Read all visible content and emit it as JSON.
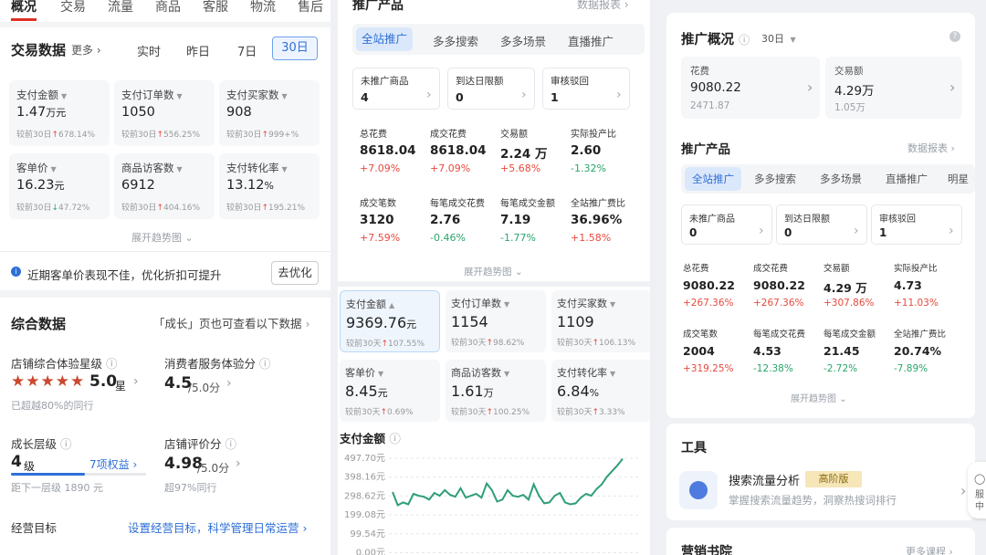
{
  "left": {
    "tabs": [
      "概况",
      "交易",
      "流量",
      "商品",
      "客服",
      "物流",
      "售后"
    ],
    "trade": {
      "title": "交易数据",
      "more": "更多",
      "ranges": [
        "实时",
        "昨日",
        "7日",
        "30日"
      ],
      "metrics": [
        {
          "label": "支付金额",
          "value": "1.47",
          "unit": "万元",
          "cmp": "较前30日",
          "delta": "678.14%",
          "dir": "up"
        },
        {
          "label": "支付订单数",
          "value": "1050",
          "unit": "",
          "cmp": "较前30日",
          "delta": "556.25%",
          "dir": "up"
        },
        {
          "label": "支付买家数",
          "value": "908",
          "unit": "",
          "cmp": "较前30日",
          "delta": "999+%",
          "dir": "up"
        },
        {
          "label": "客单价",
          "value": "16.23",
          "unit": "元",
          "cmp": "较前30日",
          "delta": "47.72%",
          "dir": "down"
        },
        {
          "label": "商品访客数",
          "value": "6912",
          "unit": "",
          "cmp": "较前30日",
          "delta": "404.16%",
          "dir": "up"
        },
        {
          "label": "支付转化率",
          "value": "13.12",
          "unit": "%",
          "cmp": "较前30日",
          "delta": "195.21%",
          "dir": "up"
        }
      ],
      "expand": "展开趋势图"
    },
    "tip": {
      "text": "近期客单价表现不佳，优化折扣可提升",
      "button": "去优化"
    },
    "summary": {
      "title": "综合数据",
      "link": "「成长」页也可查看以下数据",
      "star_label": "店铺综合体验星级",
      "star_value": "5.0",
      "star_unit": "星",
      "star_sub": "已超越80%的同行",
      "svc_label": "消费者服务体验分",
      "svc_value": "4.5",
      "svc_unit": "/5.0分",
      "growth_label": "成长层级",
      "growth_value": "4",
      "growth_unit": "级",
      "growth_benefit": "7项权益",
      "growth_sub": "距下一层级 1890 元",
      "growth_progress": 0.55,
      "eval_label": "店铺评价分",
      "eval_value": "4.98",
      "eval_unit": "/5.0分",
      "eval_sub": "超97%同行",
      "goal_label": "经营目标",
      "goal_link": "设置经营目标，科学管理日常运营"
    }
  },
  "middle": {
    "title": "推广产品",
    "report": "数据报表",
    "tabs": [
      "全站推广",
      "多多搜索",
      "多多场景",
      "直播推广"
    ],
    "status": [
      {
        "label": "未推广商品",
        "value": "4"
      },
      {
        "label": "到达日限额",
        "value": "0"
      },
      {
        "label": "审核驳回",
        "value": "1"
      }
    ],
    "stats": [
      {
        "label": "总花费",
        "value": "8618.04",
        "delta": "+7.09%",
        "dir": "up"
      },
      {
        "label": "成交花费",
        "value": "8618.04",
        "delta": "+7.09%",
        "dir": "up"
      },
      {
        "label": "交易额",
        "value": "2.24 万",
        "delta": "+5.68%",
        "dir": "up"
      },
      {
        "label": "实际投产比",
        "value": "2.60",
        "delta": "-1.32%",
        "dir": "down"
      },
      {
        "label": "成交笔数",
        "value": "3120",
        "delta": "+7.59%",
        "dir": "up"
      },
      {
        "label": "每笔成交花费",
        "value": "2.76",
        "delta": "-0.46%",
        "dir": "down"
      },
      {
        "label": "每笔成交金额",
        "value": "7.19",
        "delta": "-1.77%",
        "dir": "down"
      },
      {
        "label": "全站推广费比",
        "value": "36.96%",
        "delta": "+1.58%",
        "dir": "up"
      }
    ],
    "expand": "展开趋势图",
    "metrics": [
      {
        "label": "支付金额",
        "value": "9369.76",
        "unit": "元",
        "cmp": "较前30天",
        "delta": "107.55%",
        "dir": "up"
      },
      {
        "label": "支付订单数",
        "value": "1154",
        "unit": "",
        "cmp": "较前30天",
        "delta": "98.62%",
        "dir": "up"
      },
      {
        "label": "支付买家数",
        "value": "1109",
        "unit": "",
        "cmp": "较前30天",
        "delta": "106.13%",
        "dir": "up"
      },
      {
        "label": "客单价",
        "value": "8.45",
        "unit": "元",
        "cmp": "较前30天",
        "delta": "0.69%",
        "dir": "up"
      },
      {
        "label": "商品访客数",
        "value": "1.61",
        "unit": "万",
        "cmp": "较前30天",
        "delta": "100.25%",
        "dir": "up"
      },
      {
        "label": "支付转化率",
        "value": "6.84",
        "unit": "%",
        "cmp": "较前30天",
        "delta": "3.33%",
        "dir": "up"
      }
    ],
    "chart_title": "支付金额"
  },
  "chart_data": {
    "type": "line",
    "title": "支付金额",
    "ytick_labels": [
      "497.70元",
      "398.16元",
      "298.62元",
      "199.08元",
      "99.54元",
      "0.00元"
    ],
    "yticks": [
      497.7,
      398.16,
      298.62,
      199.08,
      99.54,
      0
    ],
    "ylim": [
      0,
      497.7
    ],
    "grid": true,
    "series": [
      {
        "values": [
          320,
          250,
          265,
          255,
          310,
          300,
          295,
          280,
          315,
          300,
          330,
          305,
          295,
          340,
          290,
          300,
          310,
          290,
          365,
          330,
          270,
          280,
          330,
          300,
          295,
          305,
          280,
          360,
          300,
          260,
          265,
          300,
          315,
          265,
          255,
          260,
          290,
          310,
          300,
          335,
          360,
          400,
          430,
          460,
          495
        ]
      }
    ],
    "color": "#2e9e7a"
  },
  "right": {
    "overview_title": "推广概况",
    "range": "30日",
    "cards": [
      {
        "label": "花费",
        "value": "9080.22",
        "sub": "2471.87"
      },
      {
        "label": "交易额",
        "value": "4.29万",
        "sub": "1.05万"
      }
    ],
    "product_title": "推广产品",
    "report": "数据报表",
    "tabs": [
      "全站推广",
      "多多搜索",
      "多多场景",
      "直播推广",
      "明星"
    ],
    "status": [
      {
        "label": "未推广商品",
        "value": "0"
      },
      {
        "label": "到达日限额",
        "value": "0"
      },
      {
        "label": "审核驳回",
        "value": "1"
      }
    ],
    "stats": [
      {
        "label": "总花费",
        "value": "9080.22",
        "delta": "+267.36%",
        "dir": "up"
      },
      {
        "label": "成交花费",
        "value": "9080.22",
        "delta": "+267.36%",
        "dir": "up"
      },
      {
        "label": "交易额",
        "value": "4.29 万",
        "delta": "+307.86%",
        "dir": "up"
      },
      {
        "label": "实际投产比",
        "value": "4.73",
        "delta": "+11.03%",
        "dir": "up"
      },
      {
        "label": "成交笔数",
        "value": "2004",
        "delta": "+319.25%",
        "dir": "up"
      },
      {
        "label": "每笔成交花费",
        "value": "4.53",
        "delta": "-12.38%",
        "dir": "down"
      },
      {
        "label": "每笔成交金额",
        "value": "21.45",
        "delta": "-2.72%",
        "dir": "down"
      },
      {
        "label": "全站推广费比",
        "value": "20.74%",
        "delta": "-7.89%",
        "dir": "down"
      }
    ],
    "expand": "展开趋势图",
    "tools_title": "工具",
    "tool_name": "搜索流量分析",
    "tool_badge": "高阶版",
    "tool_desc": "掌握搜索流量趋势，洞察热搜词排行",
    "book_title": "营销书院",
    "book_more": "更多课程",
    "float_text": "服中"
  }
}
